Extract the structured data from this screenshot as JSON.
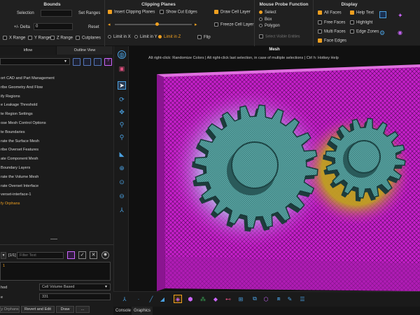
{
  "ribbon": {
    "bounds": {
      "title": "Bounds",
      "selection_label": "Selection",
      "set_ranges": "Set Ranges",
      "delta_label": "+/- Delta",
      "delta_value": "0",
      "reset": "Reset",
      "x_range": "X Range",
      "y_range": "Y Range",
      "z_range": "Z Range",
      "cutplanes": "Cutplanes"
    },
    "clipping": {
      "title": "Clipping Planes",
      "insert_clipping": "Insert Clipping Planes",
      "show_cut_edges": "Show Cut Edges",
      "limit_x": "Limit in X",
      "limit_y": "Limit in Y",
      "limit_z": "Limit in Z",
      "flip": "Flip"
    },
    "cells": {
      "draw_cell_layer": "Draw Cell Layer",
      "freeze_cell_layer": "Freeze Cell Layer"
    },
    "probe": {
      "title": "Mouse Probe Function",
      "select": "Select",
      "box": "Box",
      "polygon": "Polygon",
      "select_visible": "Select Visible Entities"
    },
    "display": {
      "title": "Display",
      "all_faces": "All Faces",
      "help_text": "Help Text",
      "free_faces": "Free Faces",
      "highlight": "Highlight",
      "multi_faces": "Multi Faces",
      "edge_zones": "Edge Zones",
      "face_edges": "Face Edges"
    }
  },
  "left": {
    "tabs": [
      "kflow",
      "Outline View"
    ],
    "workflow": [
      "ort CAD and Part Management",
      "ribe Geometry And Flow",
      "ify Regions",
      "e Leakage Threshold",
      "te Region Settings",
      "ose Mesh Control Options",
      "te Boundaries",
      "rate the Surface Mesh",
      "ribe Overset Features",
      "ate Component Mesh",
      "Boundary Layers",
      "rate the Volume Mesh",
      "rate Overset Interface",
      "verset-interface-1",
      "fy Orphans"
    ],
    "count": "[1/1]",
    "filter_placeholder": "Filter Text",
    "selected_item": "1",
    "method_label": "hod",
    "method_value": "Cell Volume Based",
    "value_label": "e",
    "value": "331",
    "buttons": {
      "orphans": "y Orphans",
      "revert": "Revert and Edit",
      "draw": "Draw",
      "more": "..."
    }
  },
  "viewport": {
    "title": "Mesh",
    "hint": "Alt right-click: Randomize Colors | Alt right-click last selection, in case of multiple selections | Ctrl h: Hotkey Help"
  },
  "bottom_tabs": [
    "Console",
    "Graphics"
  ],
  "colors": {
    "accent": "#f0a020",
    "mesh_magenta": "#c020c0",
    "gear_teal": "#5aa8a8",
    "icon_blue": "#4aa0e0"
  }
}
